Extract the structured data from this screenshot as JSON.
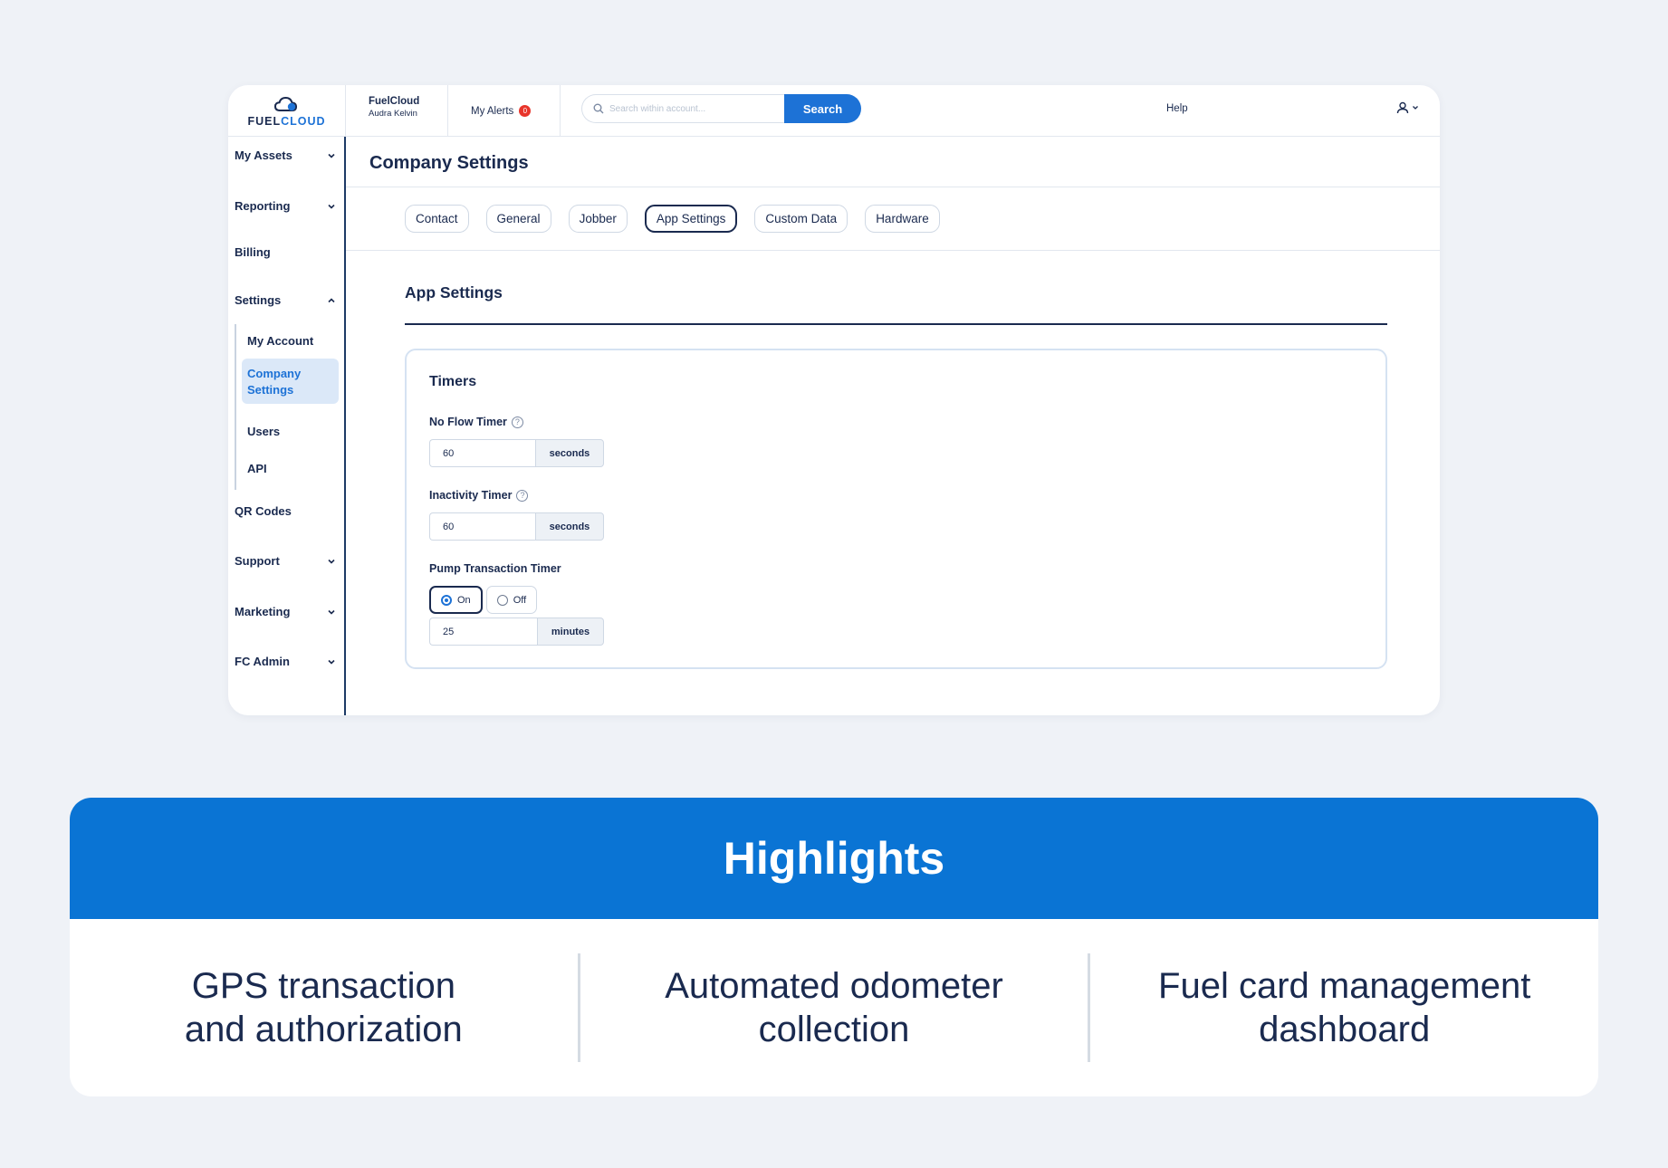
{
  "topbar": {
    "logo": {
      "part1": "FUEL",
      "part2": "CLOUD"
    },
    "company": {
      "name": "FuelCloud",
      "user": "Audra Kelvin"
    },
    "alerts": {
      "label": "My Alerts",
      "count": "0"
    },
    "search": {
      "placeholder": "Search within account...",
      "button": "Search"
    },
    "help": "Help"
  },
  "sidebar": {
    "items": {
      "assets": "My Assets",
      "reporting": "Reporting",
      "billing": "Billing",
      "settings": "Settings",
      "qr": "QR Codes",
      "support": "Support",
      "marketing": "Marketing",
      "fcadmin": "FC Admin"
    },
    "sub": {
      "account": "My Account",
      "company_line1": "Company",
      "company_line2": "Settings",
      "users": "Users",
      "api": "API"
    }
  },
  "main": {
    "title": "Company Settings",
    "tabs": [
      "Contact",
      "General",
      "Jobber",
      "App Settings",
      "Custom Data",
      "Hardware"
    ],
    "active_tab": "App Settings",
    "section_title": "App Settings",
    "timers": {
      "title": "Timers",
      "no_flow": {
        "label": "No Flow Timer",
        "value": "60",
        "unit": "seconds"
      },
      "inactivity": {
        "label": "Inactivity Timer",
        "value": "60",
        "unit": "seconds"
      },
      "pump": {
        "label": "Pump Transaction Timer",
        "on": "On",
        "off": "Off",
        "value": "25",
        "unit": "minutes"
      }
    }
  },
  "highlights": {
    "title": "Highlights",
    "items": [
      {
        "line1": "GPS transaction",
        "line2": "and authorization"
      },
      {
        "line1": "Automated odometer",
        "line2": "collection"
      },
      {
        "line1": "Fuel card management",
        "line2": "dashboard"
      }
    ]
  },
  "colors": {
    "brand": "#1d72d6",
    "navy": "#1a2a4f",
    "highlight_band": "#0a74d4",
    "alert": "#e8352b"
  }
}
